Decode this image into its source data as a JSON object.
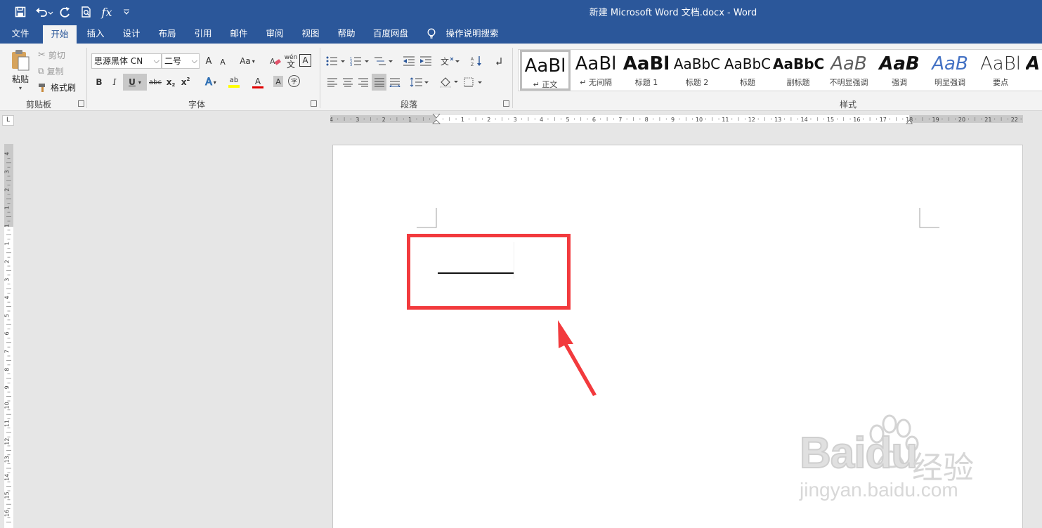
{
  "window": {
    "title": "新建 Microsoft Word 文档.docx  -  Word"
  },
  "quick_access": {
    "fx_label": "fx"
  },
  "tabs": [
    {
      "label": "文件"
    },
    {
      "label": "开始",
      "active": true
    },
    {
      "label": "插入"
    },
    {
      "label": "设计"
    },
    {
      "label": "布局"
    },
    {
      "label": "引用"
    },
    {
      "label": "邮件"
    },
    {
      "label": "审阅"
    },
    {
      "label": "视图"
    },
    {
      "label": "帮助"
    },
    {
      "label": "百度网盘"
    }
  ],
  "tell_me": {
    "label": "操作说明搜索",
    "icon": "lightbulb-icon"
  },
  "clipboard": {
    "paste_label": "粘贴",
    "cut_label": "剪切",
    "copy_label": "复制",
    "format_painter_label": "格式刷",
    "group_label": "剪贴板"
  },
  "font": {
    "font_name": "思源黑体 CN",
    "font_size": "二号",
    "grow_label": "A",
    "shrink_label": "A",
    "case_label": "Aa",
    "phonetic_label": "wén",
    "border_label": "A",
    "bold_label": "B",
    "italic_label": "I",
    "underline_label": "U",
    "strike_label": "abc",
    "subscript_label": "x",
    "superscript_label": "x",
    "highlight_label": "ab",
    "font_color_label": "A",
    "shading_label": "A",
    "enclose_label": "字",
    "group_label": "字体"
  },
  "paragraph": {
    "group_label": "段落"
  },
  "styles": {
    "group_label": "样式",
    "items": [
      {
        "preview": "AaBl",
        "name": "正文",
        "active": true
      },
      {
        "preview": "AaBl",
        "name": "无间隔"
      },
      {
        "preview": "AaBl",
        "name": "标题 1"
      },
      {
        "preview": "AaBbC",
        "name": "标题 2"
      },
      {
        "preview": "AaBbC",
        "name": "标题"
      },
      {
        "preview": "AaBbC",
        "name": "副标题"
      },
      {
        "preview": "AaB",
        "name": "不明显强调"
      },
      {
        "preview": "AaB",
        "name": "强调"
      },
      {
        "preview": "AaB",
        "name": "明显强调"
      },
      {
        "preview": "AaBl",
        "name": "要点"
      },
      {
        "preview": "A",
        "name": ""
      }
    ]
  },
  "ruler": {
    "corner_label": "L",
    "horizontal_ticks": [
      "4",
      "3",
      "2",
      "1",
      "1",
      "2",
      "3",
      "4",
      "5",
      "6",
      "7",
      "8",
      "9",
      "10",
      "11",
      "12",
      "13",
      "14",
      "15",
      "16",
      "17",
      "18",
      "19",
      "20",
      "21",
      "22"
    ],
    "vertical_ticks": [
      "4",
      "3",
      "2",
      "1",
      "1",
      "1",
      "2",
      "3",
      "4",
      "5",
      "6",
      "7",
      "8",
      "9",
      "10",
      "11",
      "12",
      "13",
      "14",
      "15",
      "16"
    ]
  },
  "watermark": {
    "brand": "Baidu",
    "cn": "经验",
    "url": "jingyan.baidu.com"
  },
  "colors": {
    "titlebar": "#2b579a",
    "ribbon": "#f3f3f3",
    "canvas": "#e6e6e6",
    "annotation": "#f23a3d"
  }
}
